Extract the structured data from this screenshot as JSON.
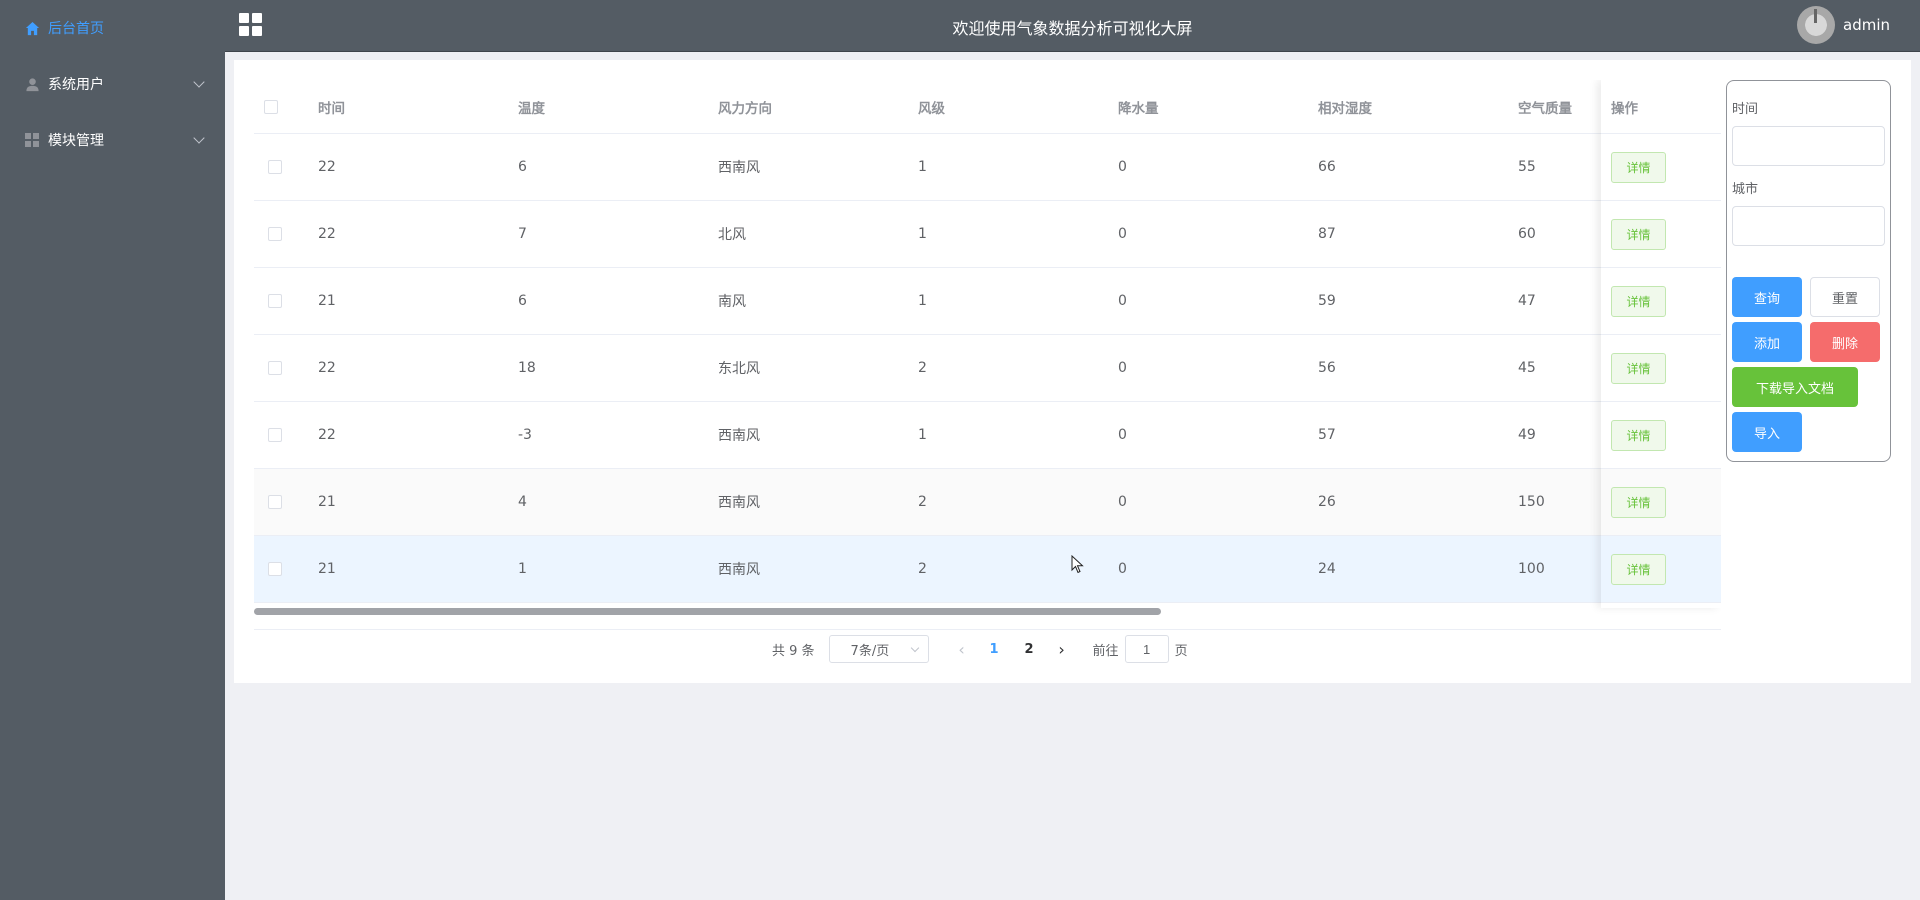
{
  "sidebar": {
    "items": [
      {
        "label": "后台首页",
        "icon": "home-icon",
        "active": true
      },
      {
        "label": "系统用户",
        "icon": "user-icon",
        "active": false
      },
      {
        "label": "模块管理",
        "icon": "grid-icon",
        "active": false
      }
    ]
  },
  "header": {
    "title": "欢迎使用气象数据分析可视化大屏",
    "username": "admin"
  },
  "table": {
    "columns": [
      "时间",
      "温度",
      "风力方向",
      "风级",
      "降水量",
      "相对湿度",
      "空气质量",
      "操作"
    ],
    "action_label": "详情",
    "rows": [
      [
        "22",
        "6",
        "西南风",
        "1",
        "0",
        "66",
        "55"
      ],
      [
        "22",
        "7",
        "北风",
        "1",
        "0",
        "87",
        "60"
      ],
      [
        "21",
        "6",
        "南风",
        "1",
        "0",
        "59",
        "47"
      ],
      [
        "22",
        "18",
        "东北风",
        "2",
        "0",
        "56",
        "45"
      ],
      [
        "22",
        "-3",
        "西南风",
        "1",
        "0",
        "57",
        "49"
      ],
      [
        "21",
        "4",
        "西南风",
        "2",
        "0",
        "26",
        "150"
      ],
      [
        "21",
        "1",
        "西南风",
        "2",
        "0",
        "24",
        "100"
      ]
    ]
  },
  "pagination": {
    "total": "共 9 条",
    "page_size": "7条/页",
    "pages": [
      "1",
      "2"
    ],
    "current": "1",
    "goto_prefix": "前往",
    "goto_value": "1",
    "goto_suffix": "页"
  },
  "search": {
    "time_label": "时间",
    "city_label": "城市",
    "query": "查询",
    "reset": "重置",
    "add": "添加",
    "delete": "删除",
    "download": "下载导入文档",
    "import": "导入"
  },
  "colors": {
    "sidebar_bg": "#545c64",
    "accent": "#409eff",
    "danger": "#f56c6c",
    "success": "#67c23a"
  }
}
